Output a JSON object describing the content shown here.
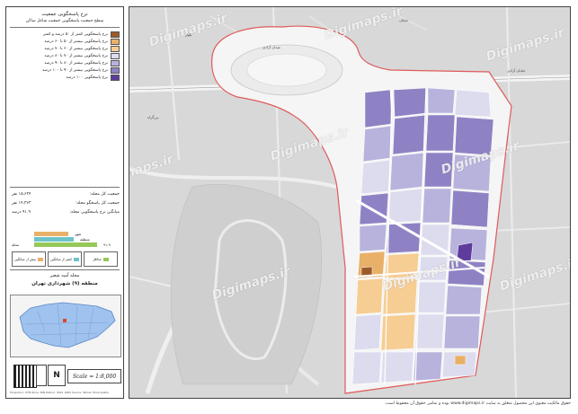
{
  "legend": {
    "title": "نرخ پاسخگویی جمعیت",
    "subtitle": "سطح جمعیت پاسخگویی جمعیت شاغل ساکن",
    "classes": [
      {
        "label": "نرخ پاسخگویی کمتر از ۵۰ درصد و کمتر",
        "color": "#9c5a2a"
      },
      {
        "label": "نرخ پاسخگویی بیشتر از ۵۰ تا ۶۰ درصد",
        "color": "#e8b068"
      },
      {
        "label": "نرخ پاسخگویی بیشتر از ۶۰ تا ۷۰ درصد",
        "color": "#f6cd92"
      },
      {
        "label": "نرخ پاسخگویی بیشتر از ۷۰ تا ۸۰ درصد",
        "color": "#dcdcee"
      },
      {
        "label": "نرخ پاسخگویی بیشتر از ۸۰ تا ۹۰ درصد",
        "color": "#b7b3dd"
      },
      {
        "label": "نرخ پاسخگویی بیشتر از ۹۰ تا ۱۰۰ درصد",
        "color": "#8f82c4"
      },
      {
        "label": "نرخ پاسخگویی ۱۰۰ درصد",
        "color": "#5f3c9c"
      }
    ],
    "stats": [
      {
        "label": "جمعیت کل محله:",
        "value": "۱۵،۶۲۴ نفر"
      },
      {
        "label": "جمعیت کل پاسخگو محله:",
        "value": "۱۴،۳۶۳ نفر"
      },
      {
        "label": "میانگین نرخ پاسخگویی محله:",
        "value": "۹۱.۹ درصد"
      }
    ],
    "bars": [
      {
        "label": "شهر",
        "color": "#e8b068"
      },
      {
        "label": "منطقه",
        "color": "#6cc3c9"
      },
      {
        "label": "محله",
        "color": "#96c85a"
      }
    ],
    "bars_value": "۹۱.۹",
    "mini_legend": [
      "بیش از میانگین",
      "کمتر از میانگین",
      "حداقل"
    ],
    "district_title": "محله آمیه شعیر",
    "district_subtitle": "منطقه (۹) شهرداری تهران",
    "scale": "Scale = 1:8,000",
    "north": "N",
    "credit": "Projection: UTM Zone 39N  Datum: WGS 1984  Source: Tehran Municipality"
  },
  "map": {
    "watermark": "Digimaps.ir",
    "labels": [
      "بلوار",
      "خیابان",
      "میدان آزادی",
      "بزرگراه",
      "خیابان آزادی"
    ]
  },
  "footer": "حقوق مالکیت معنوی این محصول متعلق به سایت www.digimaps.ir بوده و تمامی حقوق آن محفوظ است."
}
